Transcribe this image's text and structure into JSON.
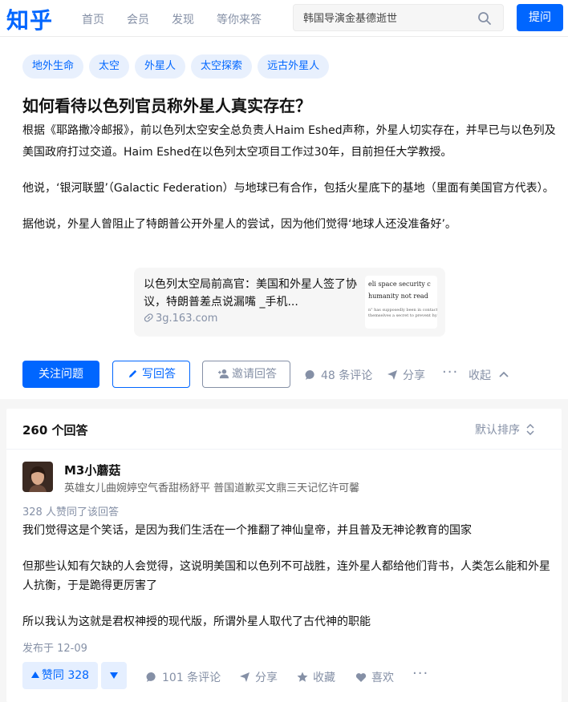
{
  "header": {
    "logo": "知乎",
    "nav": [
      "首页",
      "会员",
      "发现",
      "等你来答"
    ],
    "search_value": "韩国导演金基德逝世",
    "ask_label": "提问"
  },
  "question": {
    "tags": [
      "地外生命",
      "太空",
      "外星人",
      "太空探索",
      "远古外星人"
    ],
    "title": "如何看待以色列官员称外星人真实存在？",
    "paragraphs": [
      "根据《耶路撒冷邮报》，前以色列太空安全总负责人Haim Eshed声称，外星人切实存在，并早已与以色列及美国政府打过交道。Haim Eshed在以色列太空项目工作过30年，目前担任大学教授。",
      "他说，‘银河联盟’（Galactic Federation）与地球已有合作，包括火星底下的基地（里面有美国官方代表）。",
      "据他说，外星人曾阻止了特朗普公开外星人的尝试，因为他们觉得‘地球人还没准备好’。"
    ],
    "link_card": {
      "title": "以色列太空局前高官：美国和外星人签了协议，特朗普差点说漏嘴 _手机...",
      "url": "3g.163.com",
      "thumb_line1": "eli space security c",
      "thumb_line2": "humanity not read",
      "thumb_line3": "n\" has supposedly been in contact wi\nthemselves a secret to prevent hyster"
    },
    "actions": {
      "follow": "关注问题",
      "write": "写回答",
      "invite": "邀请回答",
      "comments": "48 条评论",
      "share": "分享",
      "collapse": "收起"
    }
  },
  "answers": {
    "count": "260 个回答",
    "sort": "默认排序",
    "first": {
      "author": "M3小蘑菇",
      "bio": "英雄女儿曲婉婷空气香甜杨舒平 普国道歉买文鼎三天记忆许可馨",
      "votes_text": "328 人赞同了该回答",
      "paragraphs": [
        "我们觉得这是个笑话，是因为我们生活在一个推翻了神仙皇帝，并且普及无神论教育的国家",
        "但那些认知有欠缺的人会觉得，这说明美国和以色列不可战胜，连外星人都给他们背书，人类怎么能和外星人抗衡，于是跪得更厉害了",
        "所以我认为这就是君权神授的现代版，所谓外星人取代了古代神的职能"
      ],
      "date": "发布于 12-09",
      "upvote": "赞同 328",
      "comments": "101 条评论",
      "share": "分享",
      "collect": "收藏",
      "like": "喜欢"
    }
  },
  "colors": {
    "brand": "#0066ff",
    "muted": "#8590a6",
    "tag_bg": "#e8f0fd"
  }
}
